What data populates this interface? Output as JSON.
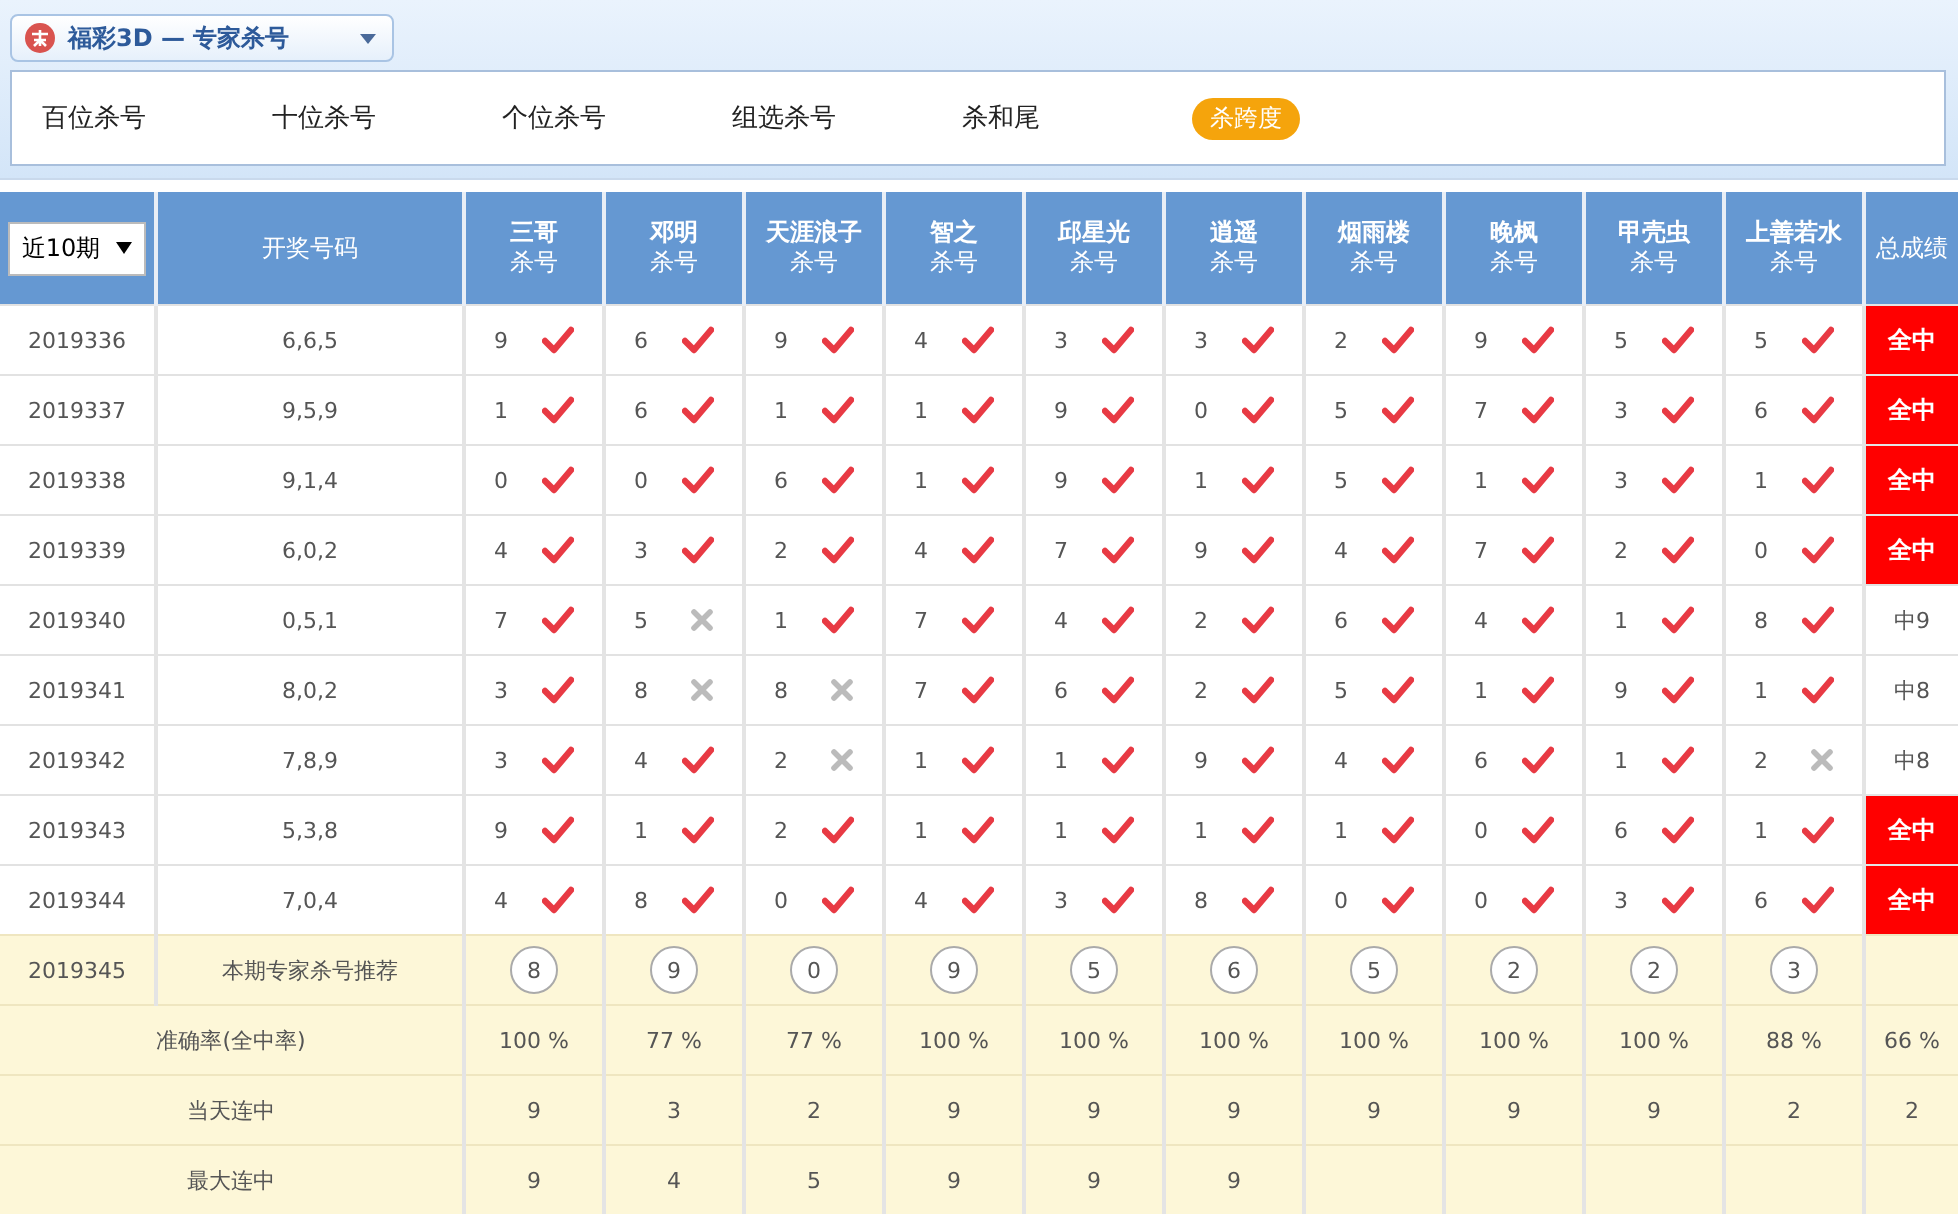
{
  "lottery_selector": {
    "value": "福彩3D — 专家杀号"
  },
  "tabs": [
    {
      "label": "百位杀号",
      "selected": false
    },
    {
      "label": "十位杀号",
      "selected": false
    },
    {
      "label": "个位杀号",
      "selected": false
    },
    {
      "label": "组选杀号",
      "selected": false
    },
    {
      "label": "杀和尾",
      "selected": false
    },
    {
      "label": "杀跨度",
      "selected": true
    }
  ],
  "table": {
    "period_filter": {
      "value": "近10期"
    },
    "draw_column": "开奖号码",
    "total_column": "总成绩",
    "experts": [
      {
        "name": "三哥",
        "sub": "杀号"
      },
      {
        "name": "邓明",
        "sub": "杀号"
      },
      {
        "name": "天涯浪子",
        "sub": "杀号"
      },
      {
        "name": "智之",
        "sub": "杀号"
      },
      {
        "name": "邱星光",
        "sub": "杀号"
      },
      {
        "name": "逍遥",
        "sub": "杀号"
      },
      {
        "name": "烟雨楼",
        "sub": "杀号"
      },
      {
        "name": "晚枫",
        "sub": "杀号"
      },
      {
        "name": "甲壳虫",
        "sub": "杀号"
      },
      {
        "name": "上善若水",
        "sub": "杀号"
      }
    ],
    "rows": [
      {
        "period": "2019336",
        "draw": "6,6,5",
        "picks": [
          {
            "n": "9",
            "hit": true
          },
          {
            "n": "6",
            "hit": true
          },
          {
            "n": "9",
            "hit": true
          },
          {
            "n": "4",
            "hit": true
          },
          {
            "n": "3",
            "hit": true
          },
          {
            "n": "3",
            "hit": true
          },
          {
            "n": "2",
            "hit": true
          },
          {
            "n": "9",
            "hit": true
          },
          {
            "n": "5",
            "hit": true
          },
          {
            "n": "5",
            "hit": true
          }
        ],
        "total": "全中",
        "full": true
      },
      {
        "period": "2019337",
        "draw": "9,5,9",
        "picks": [
          {
            "n": "1",
            "hit": true
          },
          {
            "n": "6",
            "hit": true
          },
          {
            "n": "1",
            "hit": true
          },
          {
            "n": "1",
            "hit": true
          },
          {
            "n": "9",
            "hit": true
          },
          {
            "n": "0",
            "hit": true
          },
          {
            "n": "5",
            "hit": true
          },
          {
            "n": "7",
            "hit": true
          },
          {
            "n": "3",
            "hit": true
          },
          {
            "n": "6",
            "hit": true
          }
        ],
        "total": "全中",
        "full": true
      },
      {
        "period": "2019338",
        "draw": "9,1,4",
        "picks": [
          {
            "n": "0",
            "hit": true
          },
          {
            "n": "0",
            "hit": true
          },
          {
            "n": "6",
            "hit": true
          },
          {
            "n": "1",
            "hit": true
          },
          {
            "n": "9",
            "hit": true
          },
          {
            "n": "1",
            "hit": true
          },
          {
            "n": "5",
            "hit": true
          },
          {
            "n": "1",
            "hit": true
          },
          {
            "n": "3",
            "hit": true
          },
          {
            "n": "1",
            "hit": true
          }
        ],
        "total": "全中",
        "full": true
      },
      {
        "period": "2019339",
        "draw": "6,0,2",
        "picks": [
          {
            "n": "4",
            "hit": true
          },
          {
            "n": "3",
            "hit": true
          },
          {
            "n": "2",
            "hit": true
          },
          {
            "n": "4",
            "hit": true
          },
          {
            "n": "7",
            "hit": true
          },
          {
            "n": "9",
            "hit": true
          },
          {
            "n": "4",
            "hit": true
          },
          {
            "n": "7",
            "hit": true
          },
          {
            "n": "2",
            "hit": true
          },
          {
            "n": "0",
            "hit": true
          }
        ],
        "total": "全中",
        "full": true
      },
      {
        "period": "2019340",
        "draw": "0,5,1",
        "picks": [
          {
            "n": "7",
            "hit": true
          },
          {
            "n": "5",
            "hit": false
          },
          {
            "n": "1",
            "hit": true
          },
          {
            "n": "7",
            "hit": true
          },
          {
            "n": "4",
            "hit": true
          },
          {
            "n": "2",
            "hit": true
          },
          {
            "n": "6",
            "hit": true
          },
          {
            "n": "4",
            "hit": true
          },
          {
            "n": "1",
            "hit": true
          },
          {
            "n": "8",
            "hit": true
          }
        ],
        "total": "中9",
        "full": false
      },
      {
        "period": "2019341",
        "draw": "8,0,2",
        "picks": [
          {
            "n": "3",
            "hit": true
          },
          {
            "n": "8",
            "hit": false
          },
          {
            "n": "8",
            "hit": false
          },
          {
            "n": "7",
            "hit": true
          },
          {
            "n": "6",
            "hit": true
          },
          {
            "n": "2",
            "hit": true
          },
          {
            "n": "5",
            "hit": true
          },
          {
            "n": "1",
            "hit": true
          },
          {
            "n": "9",
            "hit": true
          },
          {
            "n": "1",
            "hit": true
          }
        ],
        "total": "中8",
        "full": false
      },
      {
        "period": "2019342",
        "draw": "7,8,9",
        "picks": [
          {
            "n": "3",
            "hit": true
          },
          {
            "n": "4",
            "hit": true
          },
          {
            "n": "2",
            "hit": false
          },
          {
            "n": "1",
            "hit": true
          },
          {
            "n": "1",
            "hit": true
          },
          {
            "n": "9",
            "hit": true
          },
          {
            "n": "4",
            "hit": true
          },
          {
            "n": "6",
            "hit": true
          },
          {
            "n": "1",
            "hit": true
          },
          {
            "n": "2",
            "hit": false
          }
        ],
        "total": "中8",
        "full": false
      },
      {
        "period": "2019343",
        "draw": "5,3,8",
        "picks": [
          {
            "n": "9",
            "hit": true
          },
          {
            "n": "1",
            "hit": true
          },
          {
            "n": "2",
            "hit": true
          },
          {
            "n": "1",
            "hit": true
          },
          {
            "n": "1",
            "hit": true
          },
          {
            "n": "1",
            "hit": true
          },
          {
            "n": "1",
            "hit": true
          },
          {
            "n": "0",
            "hit": true
          },
          {
            "n": "6",
            "hit": true
          },
          {
            "n": "1",
            "hit": true
          }
        ],
        "total": "全中",
        "full": true
      },
      {
        "period": "2019344",
        "draw": "7,0,4",
        "picks": [
          {
            "n": "4",
            "hit": true
          },
          {
            "n": "8",
            "hit": true
          },
          {
            "n": "0",
            "hit": true
          },
          {
            "n": "4",
            "hit": true
          },
          {
            "n": "3",
            "hit": true
          },
          {
            "n": "8",
            "hit": true
          },
          {
            "n": "0",
            "hit": true
          },
          {
            "n": "0",
            "hit": true
          },
          {
            "n": "3",
            "hit": true
          },
          {
            "n": "6",
            "hit": true
          }
        ],
        "total": "全中",
        "full": true
      }
    ],
    "recommendation": {
      "period": "2019345",
      "label": "本期专家杀号推荐",
      "numbers": [
        "8",
        "9",
        "0",
        "9",
        "5",
        "6",
        "5",
        "2",
        "2",
        "3"
      ]
    },
    "accuracy": {
      "label": "准确率(全中率)",
      "values": [
        "100 %",
        "77 %",
        "77 %",
        "100 %",
        "100 %",
        "100 %",
        "100 %",
        "100 %",
        "100 %",
        "88 %"
      ],
      "total": "66 %"
    },
    "current_streak": {
      "label": "当天连中",
      "values": [
        "9",
        "3",
        "2",
        "9",
        "9",
        "9",
        "9",
        "9",
        "9",
        "2"
      ],
      "total": "2"
    },
    "max_streak": {
      "label": "最大连中",
      "values": [
        "9",
        "4",
        "5",
        "9",
        "9",
        "9"
      ]
    }
  }
}
